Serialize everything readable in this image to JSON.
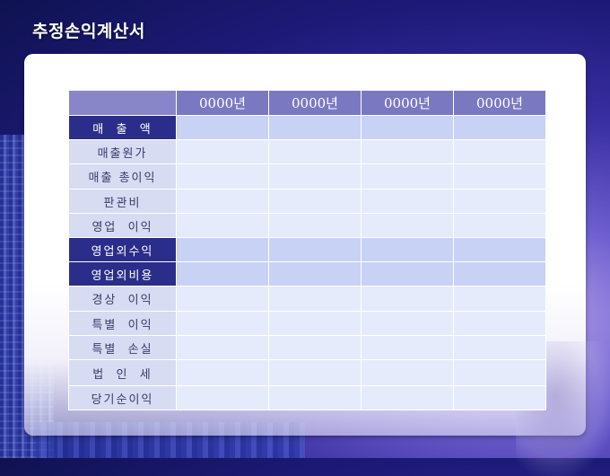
{
  "title": "추정손익계산서",
  "table": {
    "year_headers": [
      "0000년",
      "0000년",
      "0000년",
      "0000년"
    ],
    "rows": [
      {
        "label": "매  출  액",
        "style": "dark"
      },
      {
        "label": "매출원가",
        "style": "light"
      },
      {
        "label": "매출 총이익",
        "style": "light"
      },
      {
        "label": "판관비",
        "style": "light"
      },
      {
        "label": "영업  이익",
        "style": "light"
      },
      {
        "label": "영업외수익",
        "style": "dark"
      },
      {
        "label": "영업외비용",
        "style": "dark"
      },
      {
        "label": "경상  이익",
        "style": "light"
      },
      {
        "label": "특별  이익",
        "style": "light"
      },
      {
        "label": "특별  손실",
        "style": "light"
      },
      {
        "label": "법  인  세",
        "style": "light"
      },
      {
        "label": "당기순이익",
        "style": "light"
      }
    ]
  },
  "colors": {
    "header_bg": "#7b78c2",
    "dark_label_bg": "#2b2d8a",
    "light_label_bg": "#d8dcf2",
    "cell_bg": "#e6ebfb",
    "highlight_cell_bg": "#c8d2f5"
  }
}
